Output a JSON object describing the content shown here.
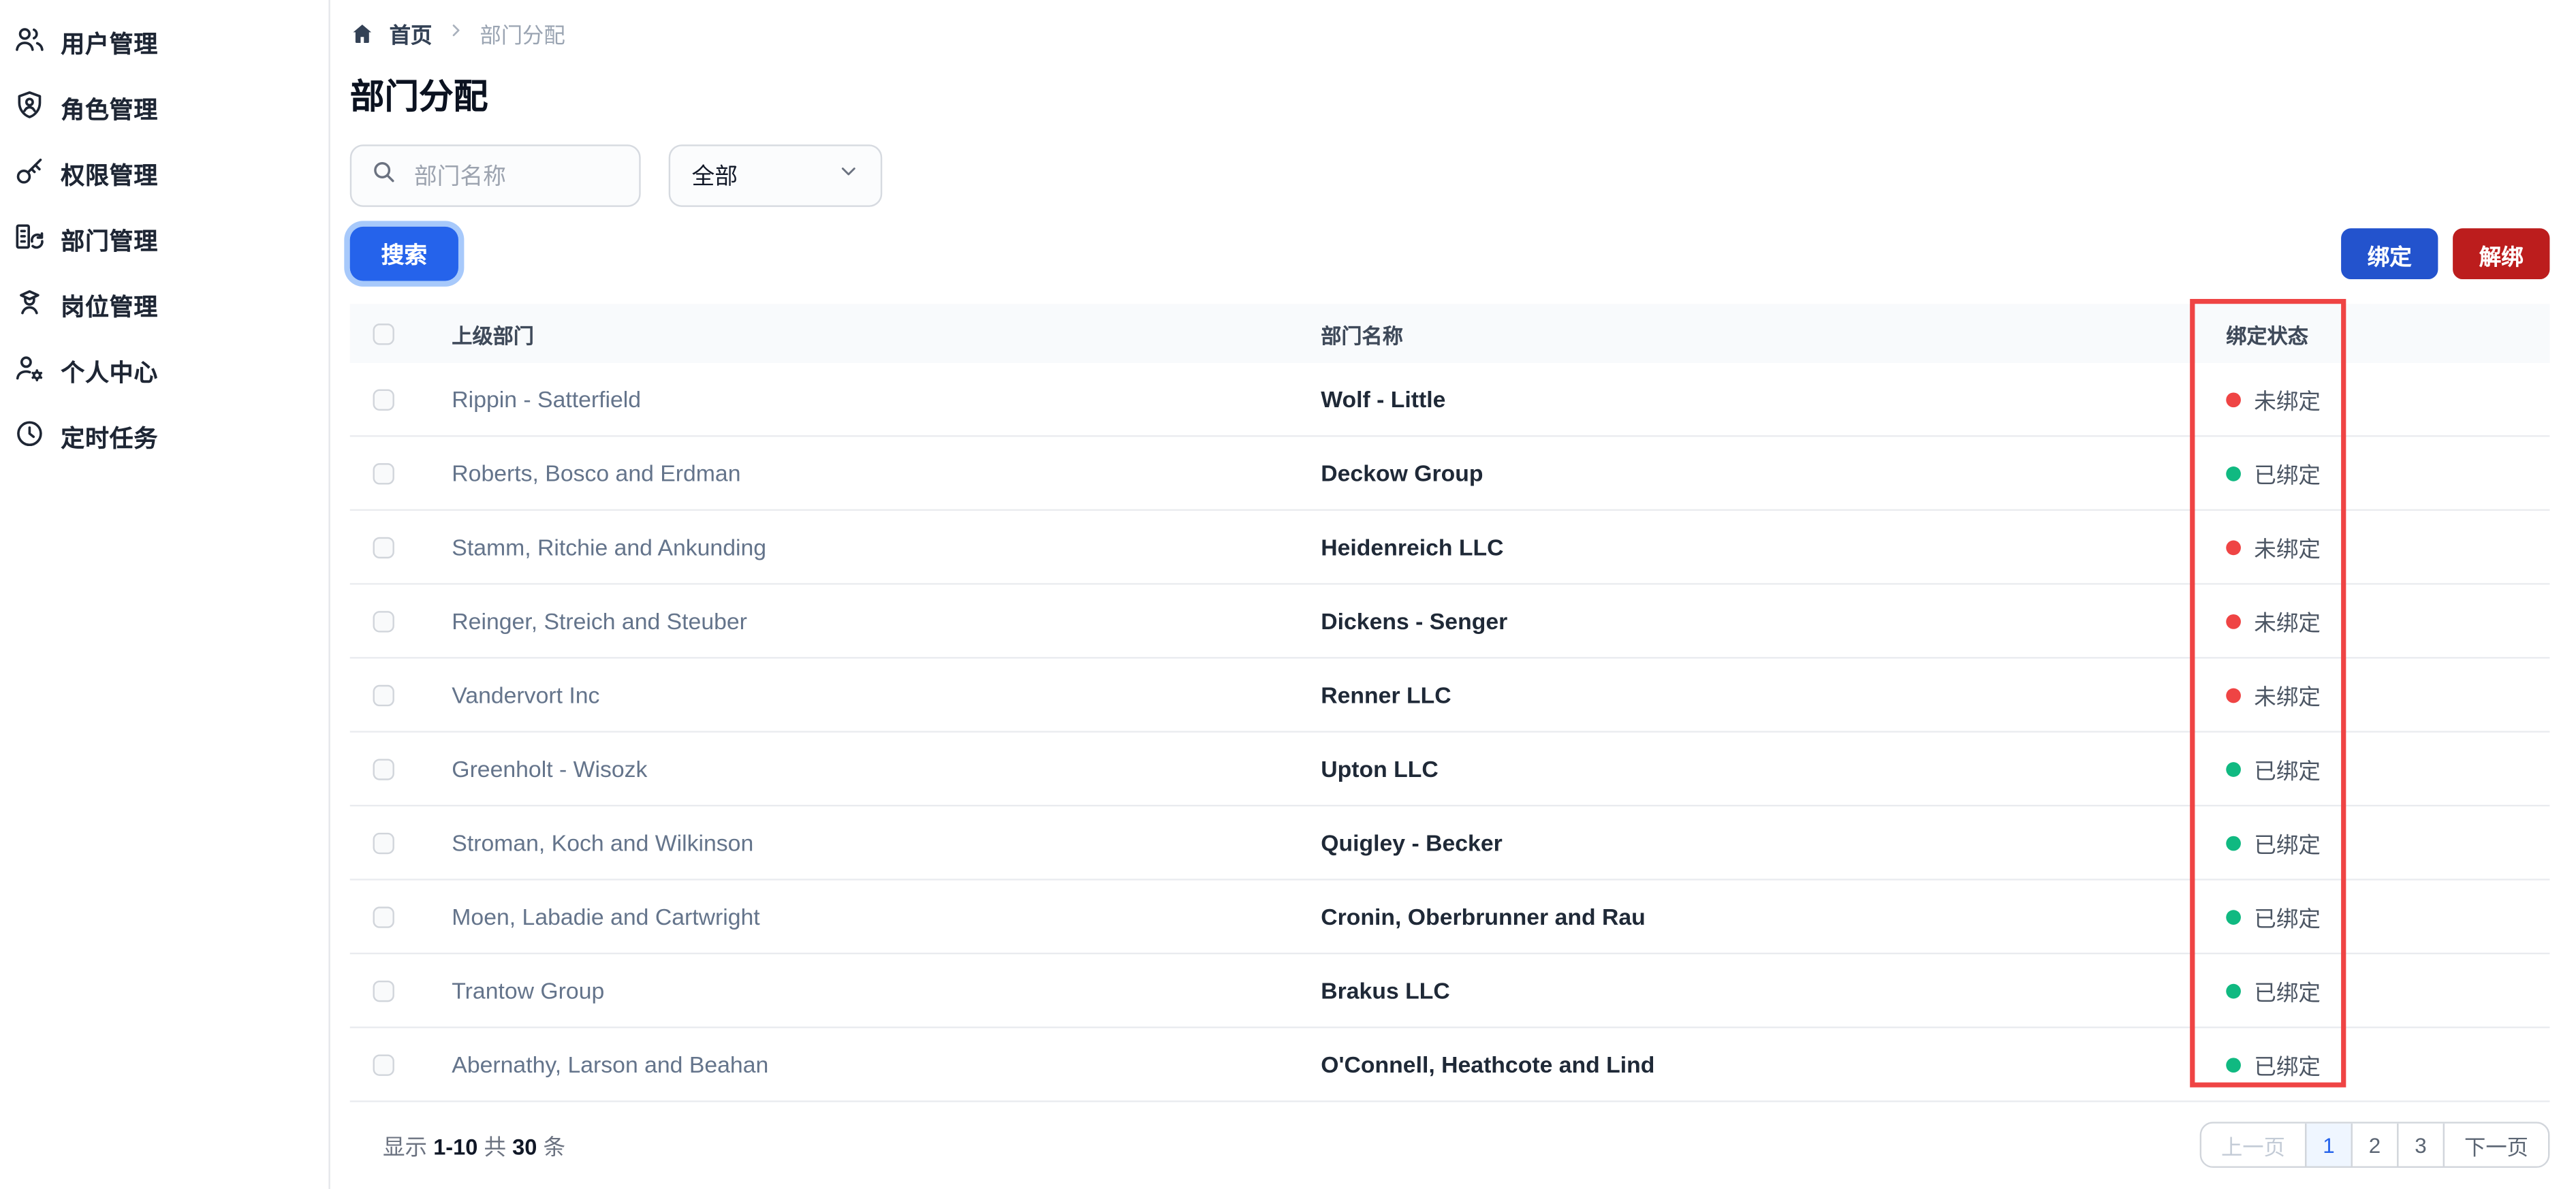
{
  "sidebar": {
    "items": [
      {
        "label": "用户管理",
        "icon": "users-icon"
      },
      {
        "label": "角色管理",
        "icon": "shield-user-icon"
      },
      {
        "label": "权限管理",
        "icon": "key-icon"
      },
      {
        "label": "部门管理",
        "icon": "department-icon"
      },
      {
        "label": "岗位管理",
        "icon": "position-icon"
      },
      {
        "label": "个人中心",
        "icon": "user-gear-icon"
      },
      {
        "label": "定时任务",
        "icon": "clock-icon"
      }
    ]
  },
  "breadcrumb": {
    "home": "首页",
    "current": "部门分配"
  },
  "page": {
    "title": "部门分配"
  },
  "filters": {
    "search_placeholder": "部门名称",
    "search_value": "",
    "select_value": "全部"
  },
  "actions": {
    "search_label": "搜索",
    "bind_label": "绑定",
    "unbind_label": "解绑"
  },
  "table": {
    "columns": {
      "parent": "上级部门",
      "name": "部门名称",
      "status": "绑定状态"
    },
    "rows": [
      {
        "parent": "Rippin - Satterfield",
        "name": "Wolf - Little",
        "status": "未绑定",
        "bound": false
      },
      {
        "parent": "Roberts, Bosco and Erdman",
        "name": "Deckow Group",
        "status": "已绑定",
        "bound": true
      },
      {
        "parent": "Stamm, Ritchie and Ankunding",
        "name": "Heidenreich LLC",
        "status": "未绑定",
        "bound": false
      },
      {
        "parent": "Reinger, Streich and Steuber",
        "name": "Dickens - Senger",
        "status": "未绑定",
        "bound": false
      },
      {
        "parent": "Vandervort Inc",
        "name": "Renner LLC",
        "status": "未绑定",
        "bound": false
      },
      {
        "parent": "Greenholt - Wisozk",
        "name": "Upton LLC",
        "status": "已绑定",
        "bound": true
      },
      {
        "parent": "Stroman, Koch and Wilkinson",
        "name": "Quigley - Becker",
        "status": "已绑定",
        "bound": true
      },
      {
        "parent": "Moen, Labadie and Cartwright",
        "name": "Cronin, Oberbrunner and Rau",
        "status": "已绑定",
        "bound": true
      },
      {
        "parent": "Trantow Group",
        "name": "Brakus LLC",
        "status": "已绑定",
        "bound": true
      },
      {
        "parent": "Abernathy, Larson and Beahan",
        "name": "O'Connell, Heathcote and Lind",
        "status": "已绑定",
        "bound": true
      }
    ]
  },
  "pagination": {
    "summary_prefix": "显示",
    "range": "1-10",
    "total_prefix": "共",
    "total": "30",
    "unit": "条",
    "prev_label": "上一页",
    "pages": [
      "1",
      "2",
      "3"
    ],
    "current_page": "1",
    "next_label": "下一页"
  },
  "colors": {
    "primary_blue": "#2563eb",
    "bind_blue": "#2353cd",
    "unbind_red": "#bc1d1d",
    "status_bound_green": "#10b981",
    "status_unbound_red": "#ef4444",
    "highlight_rectangle_red": "#ef4444",
    "header_row_bg": "#f8fafc"
  }
}
